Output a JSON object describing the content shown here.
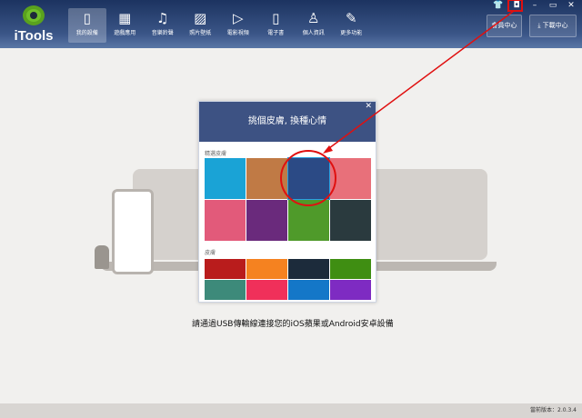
{
  "app": {
    "name": "iTools"
  },
  "nav": [
    {
      "label": "我的設備",
      "icon": "tablet-icon",
      "active": true
    },
    {
      "label": "遊戲應用",
      "icon": "apps-grid-icon"
    },
    {
      "label": "音樂鈴聲",
      "icon": "music-note-icon"
    },
    {
      "label": "照片壁紙",
      "icon": "image-icon"
    },
    {
      "label": "電影視頻",
      "icon": "play-icon"
    },
    {
      "label": "電子書",
      "icon": "book-icon"
    },
    {
      "label": "個人資訊",
      "icon": "user-icon"
    },
    {
      "label": "更多功能",
      "icon": "wrench-icon"
    }
  ],
  "header_buttons": {
    "member": "會員中心",
    "download": "下載中心"
  },
  "window_controls": [
    "skin-icon",
    "settings-icon",
    "minimize-icon",
    "restore-icon",
    "close-icon"
  ],
  "dialog": {
    "title": "挑個皮膚, 換種心情",
    "featured_label": "精選皮膚",
    "featured": [
      {
        "name": "blue",
        "color": "#1aa3d6"
      },
      {
        "name": "teddy-bear",
        "color": "#c07a45"
      },
      {
        "name": "blue-sky-itools",
        "color": "#2b4a85",
        "selected": true
      },
      {
        "name": "pink-flowers",
        "color": "#e8707a"
      },
      {
        "name": "pink-face",
        "color": "#e25a7a"
      },
      {
        "name": "purple-sparkle",
        "color": "#6a2a7c"
      },
      {
        "name": "green-football",
        "color": "#4f9a2a"
      },
      {
        "name": "dark-bokeh",
        "color": "#2a3a3e"
      }
    ],
    "skins_label": "皮膚",
    "colors": [
      "#b91c1c",
      "#f58220",
      "#1c2b3b",
      "#3f8e12",
      "#3d8a7a",
      "#f0305a",
      "#1477c8",
      "#7e2bc2"
    ]
  },
  "message": "請通過USB傳輸線連接您的iOS蘋果或Android安卓設備",
  "footer": {
    "version": "當前版本：2.0.3.4"
  },
  "annotation_color": "#e01010"
}
